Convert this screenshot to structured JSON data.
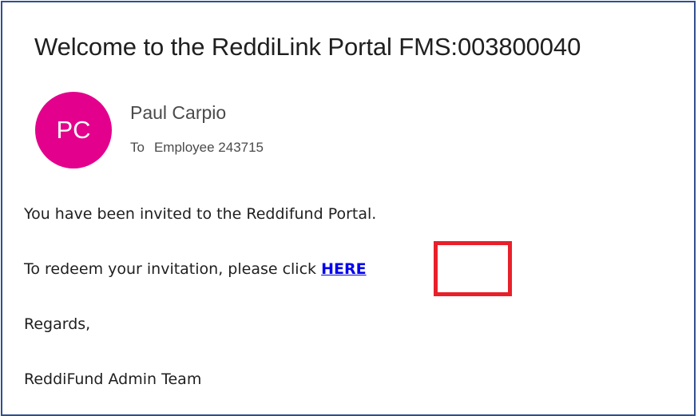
{
  "email": {
    "subject": "Welcome to the ReddiLink Portal FMS:003800040",
    "sender": {
      "initials": "PC",
      "name": "Paul Carpio",
      "avatar_color": "#e3008c"
    },
    "recipient": {
      "to_label": "To",
      "name": "Employee 243715"
    },
    "body": {
      "line1": "You have been invited to the Reddifund Portal.",
      "line2_prefix": "To redeem your invitation, please click ",
      "link_text": "HERE",
      "line3": "Regards,",
      "line4": "ReddiFund Admin Team"
    },
    "annotation_color": "#e8202a",
    "link_color": "#0000ee"
  }
}
